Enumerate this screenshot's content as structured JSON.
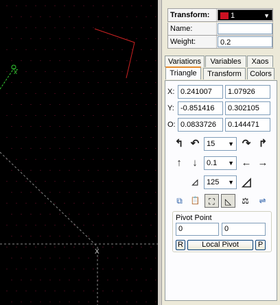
{
  "transform": {
    "label": "Transform:",
    "selected": "1",
    "color": "#cc1122"
  },
  "fields": {
    "name_label": "Name:",
    "name_value": "",
    "weight_label": "Weight:",
    "weight_value": "0.2"
  },
  "tabs_row1": [
    {
      "label": "Variations"
    },
    {
      "label": "Variables"
    },
    {
      "label": "Xaos"
    }
  ],
  "tabs_row2": [
    {
      "label": "Triangle",
      "active": true
    },
    {
      "label": "Transform"
    },
    {
      "label": "Colors"
    }
  ],
  "coords": {
    "x_label": "X:",
    "x1": "0.241007",
    "x2": "1.07926",
    "y_label": "Y:",
    "y1": "-0.851416",
    "y2": "0.302105",
    "o_label": "O:",
    "o1": "0.0833726",
    "o2": "0.144471"
  },
  "controls": {
    "rotate_step": "15",
    "move_step": "0.1",
    "scale_step": "125"
  },
  "icons": {
    "rotate_ccw_90": "↰",
    "rotate_ccw": "↶",
    "rotate_cw": "↷",
    "rotate_cw_90": "↱",
    "move_up": "↑",
    "move_down": "↓",
    "move_left": "←",
    "move_right": "→",
    "scale_down": "◿",
    "scale_up": "◿",
    "copy": "⧉",
    "paste": "📋",
    "select": "⛶",
    "triangle": "◺",
    "balance": "⚖",
    "flip": "⇌"
  },
  "pivot": {
    "title": "Pivot Point",
    "x": "0",
    "y": "0",
    "reset_label": "R",
    "local_pivot_label": "Local Pivot",
    "pick_label": "P"
  },
  "canvas": {
    "dot_color": "#7a1030",
    "line_color": "#c0c0c0",
    "triangle_color": "#cc2222",
    "selected_color": "#33cc33",
    "x_marker": "X"
  }
}
